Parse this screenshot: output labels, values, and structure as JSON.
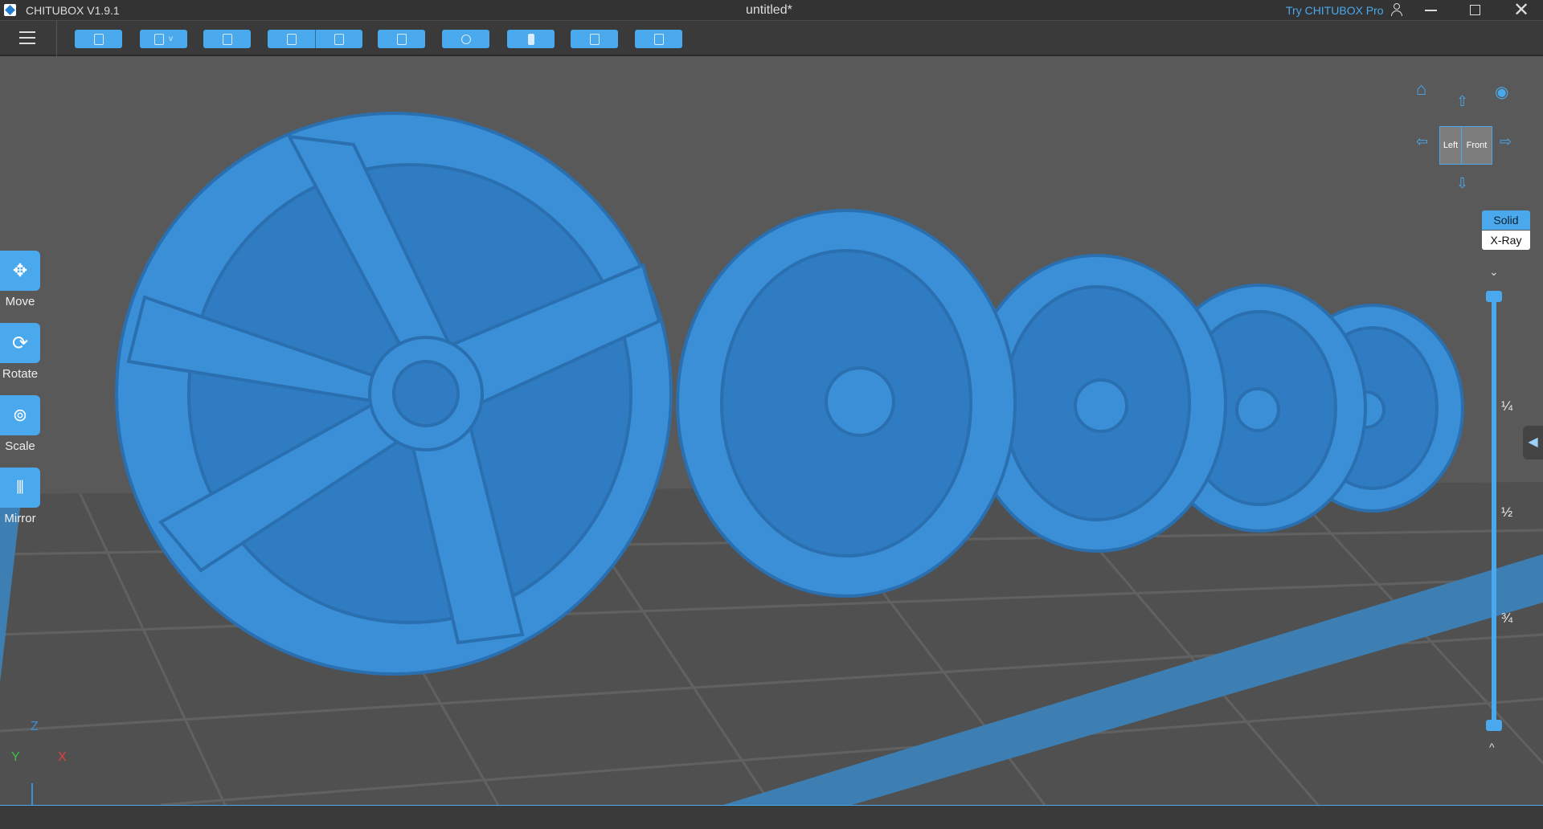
{
  "app": {
    "title": "CHITUBOX V1.9.1",
    "document": "untitled*",
    "try_pro": "Try CHITUBOX Pro"
  },
  "toolbar": {
    "buttons": [
      "open-file",
      "save",
      "crop",
      "undo",
      "redo",
      "list",
      "support",
      "print",
      "slice",
      "export"
    ]
  },
  "tools": [
    {
      "label": "Move",
      "icon": "move-icon"
    },
    {
      "label": "Rotate",
      "icon": "rotate-icon"
    },
    {
      "label": "Scale",
      "icon": "scale-icon"
    },
    {
      "label": "Mirror",
      "icon": "mirror-icon"
    }
  ],
  "viewcube": {
    "left": "Left",
    "front": "Front"
  },
  "render_mode": {
    "solid": "Solid",
    "xray": "X-Ray",
    "selected": "Solid"
  },
  "slider": {
    "marks": [
      "¼",
      "½",
      "¾"
    ],
    "top_value": 1,
    "bottom_value": 0
  },
  "axes": {
    "x": "X",
    "y": "Y",
    "z": "Z"
  },
  "colors": {
    "accent": "#4aa8ec",
    "model": "#3a8fd6",
    "background": "#595959"
  }
}
